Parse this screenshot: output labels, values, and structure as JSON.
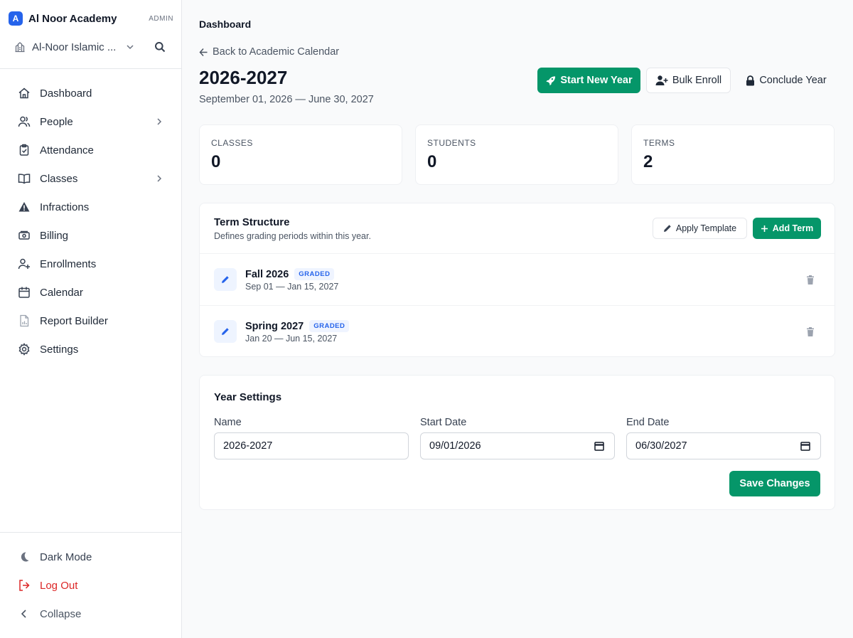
{
  "sidebar": {
    "brand_logo": "A",
    "brand_name": "Al Noor Academy",
    "role": "ADMIN",
    "school": "Al-Noor Islamic ...",
    "nav": [
      {
        "label": "Dashboard",
        "icon": "home-icon"
      },
      {
        "label": "People",
        "icon": "users-icon",
        "has_children": true
      },
      {
        "label": "Attendance",
        "icon": "clipboard-check-icon"
      },
      {
        "label": "Classes",
        "icon": "book-open-icon",
        "has_children": true
      },
      {
        "label": "Infractions",
        "icon": "warning-icon"
      },
      {
        "label": "Billing",
        "icon": "cash-icon"
      },
      {
        "label": "Enrollments",
        "icon": "user-plus-icon"
      },
      {
        "label": "Calendar",
        "icon": "calendar-icon"
      },
      {
        "label": "Report Builder",
        "icon": "report-icon"
      },
      {
        "label": "Settings",
        "icon": "gear-icon"
      }
    ],
    "dark_mode": "Dark Mode",
    "logout": "Log Out",
    "collapse": "Collapse"
  },
  "header": {
    "breadcrumb": "Dashboard",
    "back_link": "Back to Academic Calendar",
    "year_title": "2026-2027",
    "year_range": "September 01, 2026 — June 30, 2027",
    "actions": {
      "start_new_year": "Start New Year",
      "bulk_enroll": "Bulk Enroll",
      "conclude_year": "Conclude Year"
    }
  },
  "stats": [
    {
      "label": "CLASSES",
      "value": "0"
    },
    {
      "label": "STUDENTS",
      "value": "0"
    },
    {
      "label": "TERMS",
      "value": "2"
    }
  ],
  "term_structure": {
    "title": "Term Structure",
    "subtitle": "Defines grading periods within this year.",
    "apply_template": "Apply Template",
    "add_term": "Add Term",
    "terms": [
      {
        "name": "Fall 2026",
        "badge": "GRADED",
        "dates": "Sep 01 — Jan 15, 2027"
      },
      {
        "name": "Spring 2027",
        "badge": "GRADED",
        "dates": "Jan 20 — Jun 15, 2027"
      }
    ]
  },
  "year_settings": {
    "title": "Year Settings",
    "name_label": "Name",
    "name_value": "2026-2027",
    "start_label": "Start Date",
    "start_value": "09/01/2026",
    "end_label": "End Date",
    "end_value": "06/30/2027",
    "save": "Save Changes"
  },
  "colors": {
    "accent_green": "#059669",
    "brand_blue": "#2563eb",
    "danger_red": "#dc2626"
  }
}
